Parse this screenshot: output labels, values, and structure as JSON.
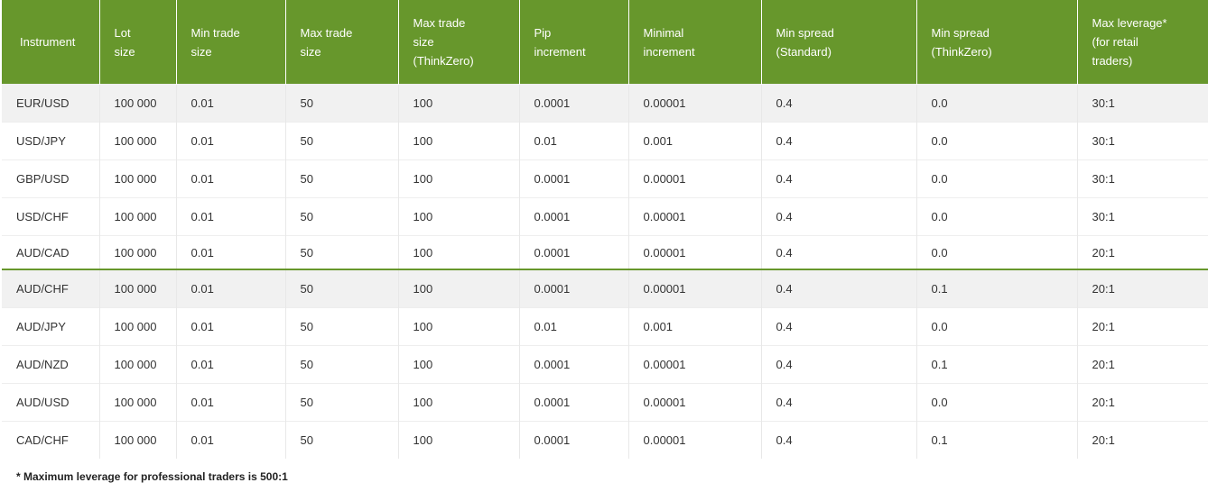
{
  "table": {
    "headers": [
      "Instrument",
      "Lot\nsize",
      "Min trade\nsize",
      "Max trade\nsize",
      "Max trade\nsize\n(ThinkZero)",
      "Pip\nincrement",
      "Minimal\nincrement",
      "Min spread\n(Standard)",
      "Min spread\n(ThinkZero)",
      "Max leverage*\n(for retail\ntraders)"
    ],
    "rows": [
      [
        "EUR/USD",
        "100 000",
        "0.01",
        "50",
        "100",
        "0.0001",
        "0.00001",
        "0.4",
        "0.0",
        "30:1"
      ],
      [
        "USD/JPY",
        "100 000",
        "0.01",
        "50",
        "100",
        "0.01",
        "0.001",
        "0.4",
        "0.0",
        "30:1"
      ],
      [
        "GBP/USD",
        "100 000",
        "0.01",
        "50",
        "100",
        "0.0001",
        "0.00001",
        "0.4",
        "0.0",
        "30:1"
      ],
      [
        "USD/CHF",
        "100 000",
        "0.01",
        "50",
        "100",
        "0.0001",
        "0.00001",
        "0.4",
        "0.0",
        "30:1"
      ],
      [
        "AUD/CAD",
        "100 000",
        "0.01",
        "50",
        "100",
        "0.0001",
        "0.00001",
        "0.4",
        "0.0",
        "20:1"
      ],
      [
        "AUD/CHF",
        "100 000",
        "0.01",
        "50",
        "100",
        "0.0001",
        "0.00001",
        "0.4",
        "0.1",
        "20:1"
      ],
      [
        "AUD/JPY",
        "100 000",
        "0.01",
        "50",
        "100",
        "0.01",
        "0.001",
        "0.4",
        "0.0",
        "20:1"
      ],
      [
        "AUD/NZD",
        "100 000",
        "0.01",
        "50",
        "100",
        "0.0001",
        "0.00001",
        "0.4",
        "0.1",
        "20:1"
      ],
      [
        "AUD/USD",
        "100 000",
        "0.01",
        "50",
        "100",
        "0.0001",
        "0.00001",
        "0.4",
        "0.0",
        "20:1"
      ],
      [
        "CAD/CHF",
        "100 000",
        "0.01",
        "50",
        "100",
        "0.0001",
        "0.00001",
        "0.4",
        "0.1",
        "20:1"
      ]
    ]
  },
  "footnote": "* Maximum leverage for professional traders is 500:1",
  "colors": {
    "header_bg": "#67972c",
    "header_text": "#ffffff",
    "shaded_row": "#f1f1f1"
  }
}
